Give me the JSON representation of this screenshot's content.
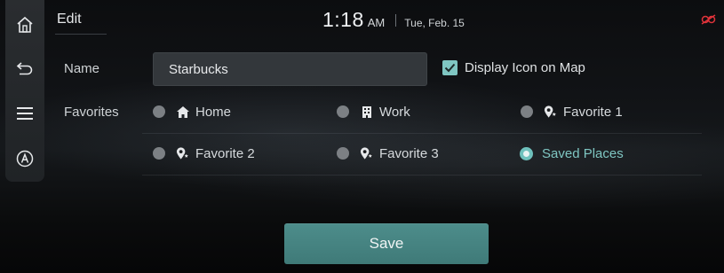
{
  "header": {
    "title": "Edit",
    "time": "1:18",
    "ampm": "AM",
    "date": "Tue, Feb. 15"
  },
  "sidebar": {
    "items": [
      {
        "icon": "home-icon"
      },
      {
        "icon": "back-icon"
      },
      {
        "icon": "menu-icon"
      },
      {
        "icon": "auto-a-icon"
      }
    ]
  },
  "form": {
    "name_label": "Name",
    "name_value": "Starbucks",
    "display_icon_label": "Display Icon on Map",
    "display_icon_checked": true,
    "favorites_label": "Favorites",
    "favorites": [
      {
        "label": "Home",
        "icon": "house-icon",
        "selected": false
      },
      {
        "label": "Work",
        "icon": "building-icon",
        "selected": false
      },
      {
        "label": "Favorite 1",
        "icon": "favorite-pin-icon",
        "selected": false
      },
      {
        "label": "Favorite 2",
        "icon": "favorite-pin-icon",
        "selected": false
      },
      {
        "label": "Favorite 3",
        "icon": "favorite-pin-icon",
        "selected": false
      },
      {
        "label": "Saved Places",
        "icon": "",
        "selected": true
      }
    ]
  },
  "actions": {
    "save_label": "Save"
  },
  "colors": {
    "accent": "#7fc6c2",
    "save_button": "#4a8987",
    "status_icon": "#e0333a"
  }
}
